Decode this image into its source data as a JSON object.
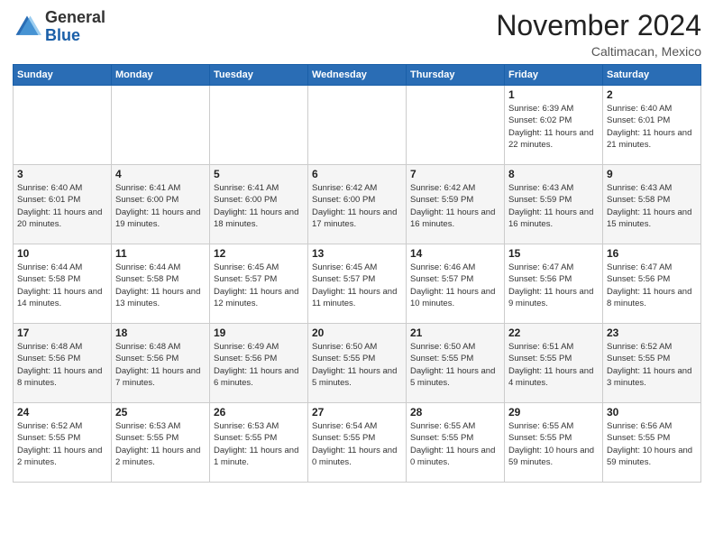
{
  "header": {
    "logo": {
      "line1": "General",
      "line2": "Blue"
    },
    "month": "November 2024",
    "location": "Caltimacan, Mexico"
  },
  "weekdays": [
    "Sunday",
    "Monday",
    "Tuesday",
    "Wednesday",
    "Thursday",
    "Friday",
    "Saturday"
  ],
  "weeks": [
    [
      {
        "day": "",
        "info": ""
      },
      {
        "day": "",
        "info": ""
      },
      {
        "day": "",
        "info": ""
      },
      {
        "day": "",
        "info": ""
      },
      {
        "day": "",
        "info": ""
      },
      {
        "day": "1",
        "info": "Sunrise: 6:39 AM\nSunset: 6:02 PM\nDaylight: 11 hours and 22 minutes."
      },
      {
        "day": "2",
        "info": "Sunrise: 6:40 AM\nSunset: 6:01 PM\nDaylight: 11 hours and 21 minutes."
      }
    ],
    [
      {
        "day": "3",
        "info": "Sunrise: 6:40 AM\nSunset: 6:01 PM\nDaylight: 11 hours and 20 minutes."
      },
      {
        "day": "4",
        "info": "Sunrise: 6:41 AM\nSunset: 6:00 PM\nDaylight: 11 hours and 19 minutes."
      },
      {
        "day": "5",
        "info": "Sunrise: 6:41 AM\nSunset: 6:00 PM\nDaylight: 11 hours and 18 minutes."
      },
      {
        "day": "6",
        "info": "Sunrise: 6:42 AM\nSunset: 6:00 PM\nDaylight: 11 hours and 17 minutes."
      },
      {
        "day": "7",
        "info": "Sunrise: 6:42 AM\nSunset: 5:59 PM\nDaylight: 11 hours and 16 minutes."
      },
      {
        "day": "8",
        "info": "Sunrise: 6:43 AM\nSunset: 5:59 PM\nDaylight: 11 hours and 16 minutes."
      },
      {
        "day": "9",
        "info": "Sunrise: 6:43 AM\nSunset: 5:58 PM\nDaylight: 11 hours and 15 minutes."
      }
    ],
    [
      {
        "day": "10",
        "info": "Sunrise: 6:44 AM\nSunset: 5:58 PM\nDaylight: 11 hours and 14 minutes."
      },
      {
        "day": "11",
        "info": "Sunrise: 6:44 AM\nSunset: 5:58 PM\nDaylight: 11 hours and 13 minutes."
      },
      {
        "day": "12",
        "info": "Sunrise: 6:45 AM\nSunset: 5:57 PM\nDaylight: 11 hours and 12 minutes."
      },
      {
        "day": "13",
        "info": "Sunrise: 6:45 AM\nSunset: 5:57 PM\nDaylight: 11 hours and 11 minutes."
      },
      {
        "day": "14",
        "info": "Sunrise: 6:46 AM\nSunset: 5:57 PM\nDaylight: 11 hours and 10 minutes."
      },
      {
        "day": "15",
        "info": "Sunrise: 6:47 AM\nSunset: 5:56 PM\nDaylight: 11 hours and 9 minutes."
      },
      {
        "day": "16",
        "info": "Sunrise: 6:47 AM\nSunset: 5:56 PM\nDaylight: 11 hours and 8 minutes."
      }
    ],
    [
      {
        "day": "17",
        "info": "Sunrise: 6:48 AM\nSunset: 5:56 PM\nDaylight: 11 hours and 8 minutes."
      },
      {
        "day": "18",
        "info": "Sunrise: 6:48 AM\nSunset: 5:56 PM\nDaylight: 11 hours and 7 minutes."
      },
      {
        "day": "19",
        "info": "Sunrise: 6:49 AM\nSunset: 5:56 PM\nDaylight: 11 hours and 6 minutes."
      },
      {
        "day": "20",
        "info": "Sunrise: 6:50 AM\nSunset: 5:55 PM\nDaylight: 11 hours and 5 minutes."
      },
      {
        "day": "21",
        "info": "Sunrise: 6:50 AM\nSunset: 5:55 PM\nDaylight: 11 hours and 5 minutes."
      },
      {
        "day": "22",
        "info": "Sunrise: 6:51 AM\nSunset: 5:55 PM\nDaylight: 11 hours and 4 minutes."
      },
      {
        "day": "23",
        "info": "Sunrise: 6:52 AM\nSunset: 5:55 PM\nDaylight: 11 hours and 3 minutes."
      }
    ],
    [
      {
        "day": "24",
        "info": "Sunrise: 6:52 AM\nSunset: 5:55 PM\nDaylight: 11 hours and 2 minutes."
      },
      {
        "day": "25",
        "info": "Sunrise: 6:53 AM\nSunset: 5:55 PM\nDaylight: 11 hours and 2 minutes."
      },
      {
        "day": "26",
        "info": "Sunrise: 6:53 AM\nSunset: 5:55 PM\nDaylight: 11 hours and 1 minute."
      },
      {
        "day": "27",
        "info": "Sunrise: 6:54 AM\nSunset: 5:55 PM\nDaylight: 11 hours and 0 minutes."
      },
      {
        "day": "28",
        "info": "Sunrise: 6:55 AM\nSunset: 5:55 PM\nDaylight: 11 hours and 0 minutes."
      },
      {
        "day": "29",
        "info": "Sunrise: 6:55 AM\nSunset: 5:55 PM\nDaylight: 10 hours and 59 minutes."
      },
      {
        "day": "30",
        "info": "Sunrise: 6:56 AM\nSunset: 5:55 PM\nDaylight: 10 hours and 59 minutes."
      }
    ]
  ]
}
